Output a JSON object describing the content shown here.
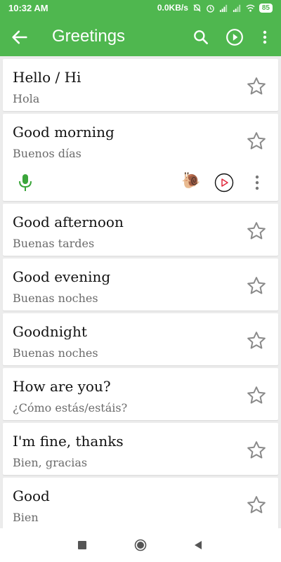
{
  "status_bar": {
    "time": "10:32 AM",
    "network_speed": "0.0KB/s",
    "battery": "85",
    "icons": [
      "mute-icon",
      "alarm-icon",
      "signal-icon",
      "signal-icon",
      "wifi-icon",
      "battery-icon"
    ]
  },
  "app_bar": {
    "title": "Greetings",
    "back_icon": "arrow-back-icon",
    "search_icon": "search-icon",
    "play_icon": "play-circle-icon",
    "more_icon": "more-vert-icon",
    "color": "#4fb74f"
  },
  "phrases": [
    {
      "english": "Hello / Hi",
      "spanish": "Hola"
    },
    {
      "english": "Good morning",
      "spanish": "Buenos días"
    },
    {
      "english": "Good afternoon",
      "spanish": "Buenas tardes"
    },
    {
      "english": "Good evening",
      "spanish": "Buenas noches"
    },
    {
      "english": "Goodnight",
      "spanish": "Buenas noches"
    },
    {
      "english": "How are you?",
      "spanish": "¿Cómo estás/estáis?"
    },
    {
      "english": "I'm fine, thanks",
      "spanish": "Bien, gracias"
    },
    {
      "english": "Good",
      "spanish": "Bien"
    }
  ],
  "expanded_tools": {
    "mic_icon": "microphone-icon",
    "slow_icon": "snail-icon",
    "play_icon": "play-circle-red-icon",
    "more_icon": "more-vert-icon",
    "mic_color": "#3aa53a",
    "play_color": "#e0283c"
  },
  "nav_bar": {
    "icons": [
      "recents-square-icon",
      "home-circle-icon",
      "back-triangle-icon"
    ]
  }
}
